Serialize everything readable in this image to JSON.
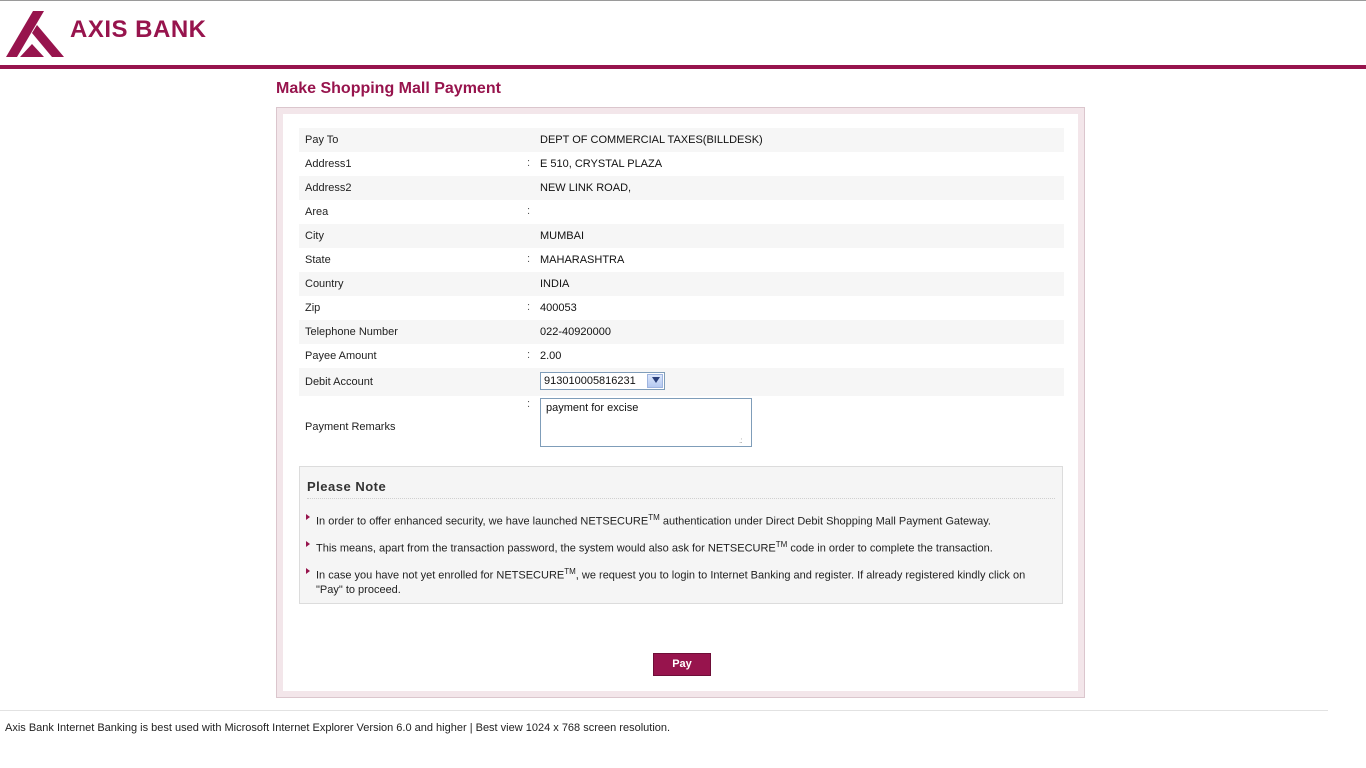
{
  "bank": {
    "name": "AXIS BANK",
    "brand_color": "#97144d"
  },
  "page": {
    "title": "Make Shopping Mall Payment"
  },
  "details": [
    {
      "label": "Pay To",
      "colon": "",
      "value": "DEPT OF COMMERCIAL TAXES(BILLDESK)"
    },
    {
      "label": "Address1",
      "colon": ":",
      "value": "E 510, CRYSTAL PLAZA"
    },
    {
      "label": "Address2",
      "colon": "",
      "value": "NEW LINK ROAD,"
    },
    {
      "label": "Area",
      "colon": ":",
      "value": ""
    },
    {
      "label": "City",
      "colon": "",
      "value": "MUMBAI"
    },
    {
      "label": "State",
      "colon": ":",
      "value": "MAHARASHTRA"
    },
    {
      "label": "Country",
      "colon": "",
      "value": "INDIA"
    },
    {
      "label": "Zip",
      "colon": ":",
      "value": "400053"
    },
    {
      "label": "Telephone Number",
      "colon": "",
      "value": "022-40920000"
    },
    {
      "label": "Payee Amount",
      "colon": ":",
      "value": "2.00"
    }
  ],
  "debit_account": {
    "label": "Debit Account",
    "selected": "913010005816231"
  },
  "payment_remarks": {
    "label": "Payment Remarks",
    "colon": ":",
    "value": "payment for excise"
  },
  "note": {
    "title": "Please Note",
    "tm": "TM",
    "items": [
      {
        "before": "In order to offer enhanced security, we have launched NETSECURE",
        "after": " authentication under Direct Debit Shopping Mall Payment Gateway."
      },
      {
        "before": "This means, apart from the transaction password, the system would also ask for NETSECURE",
        "after": " code in order to complete the transaction."
      },
      {
        "before": "In case you have not yet enrolled for NETSECURE",
        "after": ", we request you to login to Internet Banking and register. If already registered kindly click on \"Pay\" to proceed."
      }
    ]
  },
  "pay_button": "Pay",
  "footer": "Axis Bank Internet Banking is best used with Microsoft Internet Explorer Version 6.0 and higher | Best view 1024 x 768 screen resolution."
}
